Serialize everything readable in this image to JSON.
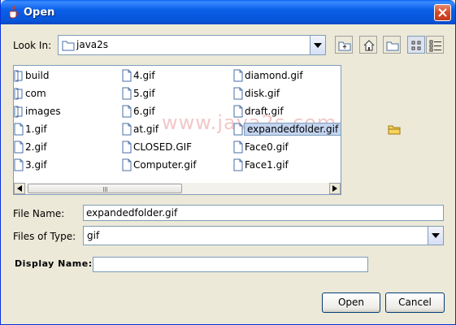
{
  "window": {
    "title": "Open"
  },
  "look_in": {
    "label": "Look In:",
    "value": "java2s"
  },
  "toolbar": [
    "up-one-level",
    "home",
    "new-folder",
    "list-view",
    "details-view"
  ],
  "files": [
    {
      "name": "build",
      "kind": "folder"
    },
    {
      "name": "com",
      "kind": "folder"
    },
    {
      "name": "images",
      "kind": "folder"
    },
    {
      "name": "1.gif",
      "kind": "file"
    },
    {
      "name": "2.gif",
      "kind": "file"
    },
    {
      "name": "3.gif",
      "kind": "file"
    },
    {
      "name": "4.gif",
      "kind": "file"
    },
    {
      "name": "5.gif",
      "kind": "file"
    },
    {
      "name": "6.gif",
      "kind": "file"
    },
    {
      "name": "at.gif",
      "kind": "file"
    },
    {
      "name": "CLOSED.GIF",
      "kind": "file"
    },
    {
      "name": "Computer.gif",
      "kind": "file"
    },
    {
      "name": "diamond.gif",
      "kind": "file"
    },
    {
      "name": "disk.gif",
      "kind": "file"
    },
    {
      "name": "draft.gif",
      "kind": "file"
    },
    {
      "name": "expandedfolder.gif",
      "kind": "file",
      "selected": true
    },
    {
      "name": "Face0.gif",
      "kind": "file"
    },
    {
      "name": "Face1.gif",
      "kind": "file"
    }
  ],
  "watermark": "www.java2s.com",
  "file_name": {
    "label": "File Name:",
    "value": "expandedfolder.gif"
  },
  "files_of_type": {
    "label": "Files of Type:",
    "value": "gif"
  },
  "display_name": {
    "label": "Display Name:",
    "value": ""
  },
  "buttons": {
    "open": "Open",
    "cancel": "Cancel"
  },
  "colors": {
    "titlebar": "#0755d9",
    "selection": "#c3d4f0",
    "border": "#7f9db9"
  }
}
